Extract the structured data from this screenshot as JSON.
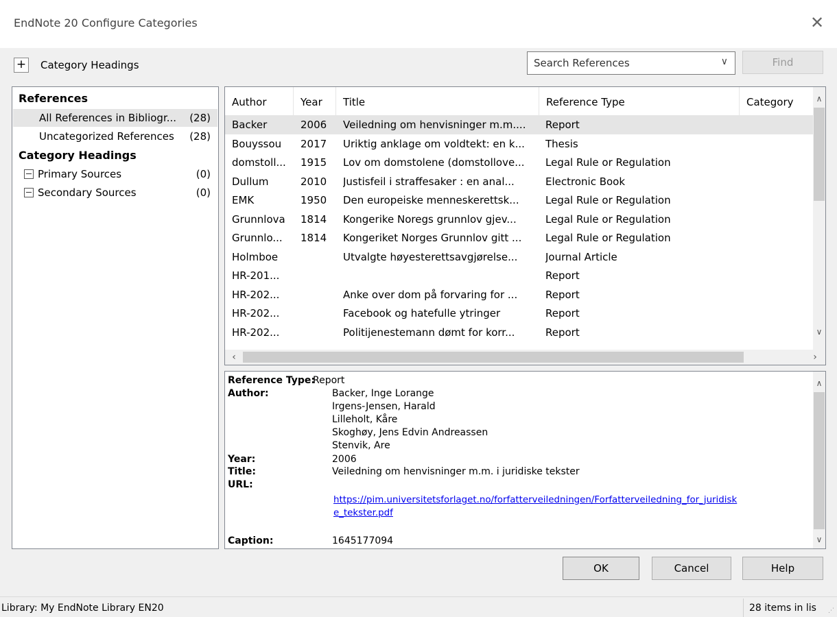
{
  "window": {
    "title": "EndNote 20 Configure Categories",
    "close_glyph": "✕"
  },
  "toolbar": {
    "add_glyph": "+",
    "label": "Category Headings"
  },
  "search": {
    "placeholder": "Search References",
    "find_label": "Find"
  },
  "sidebar": {
    "references_heading": "References",
    "items": [
      {
        "label": "All References in Bibliogr...",
        "count": "(28)"
      },
      {
        "label": "Uncategorized References",
        "count": "(28)"
      }
    ],
    "category_heading": "Category Headings",
    "categories": [
      {
        "label": "Primary Sources",
        "count": "(0)"
      },
      {
        "label": "Secondary Sources",
        "count": "(0)"
      }
    ]
  },
  "table": {
    "columns": [
      "Author",
      "Year",
      "Title",
      "Reference Type",
      "Category"
    ],
    "rows": [
      {
        "author": "Backer",
        "year": "2006",
        "title": "Veiledning om henvisninger m.m....",
        "type": "Report"
      },
      {
        "author": "Bouyssou",
        "year": "2017",
        "title": "Uriktig anklage om voldtekt: en k...",
        "type": "Thesis"
      },
      {
        "author": "domstoll...",
        "year": "1915",
        "title": "Lov om domstolene (domstollove...",
        "type": "Legal Rule or Regulation"
      },
      {
        "author": "Dullum",
        "year": "2010",
        "title": "Justisfeil i straffesaker : en anal...",
        "type": "Electronic Book"
      },
      {
        "author": "EMK",
        "year": "1950",
        "title": "Den europeiske menneskerettsk...",
        "type": "Legal Rule or Regulation"
      },
      {
        "author": "Grunnlova",
        "year": "1814",
        "title": "Kongerike Noregs grunnlov gjev...",
        "type": "Legal Rule or Regulation"
      },
      {
        "author": "Grunnlo...",
        "year": "1814",
        "title": "Kongeriket Norges Grunnlov gitt ...",
        "type": "Legal Rule or Regulation"
      },
      {
        "author": "Holmboe",
        "year": "",
        "title": "Utvalgte høyesterettsavgjørelse...",
        "type": "Journal Article"
      },
      {
        "author": "HR-201...",
        "year": "",
        "title": "",
        "type": "Report"
      },
      {
        "author": "HR-202...",
        "year": "",
        "title": "Anke over dom på forvaring for ...",
        "type": "Report"
      },
      {
        "author": "HR-202...",
        "year": "",
        "title": "Facebook og hatefulle ytringer",
        "type": "Report"
      },
      {
        "author": "HR-202...",
        "year": "",
        "title": "Politijenestemann dømt for korr...",
        "type": "Report"
      }
    ]
  },
  "detail": {
    "type_label": "Reference Type:",
    "type_value": "Report",
    "author_label": "Author:",
    "authors": [
      "Backer, Inge Lorange",
      "Irgens-Jensen, Harald",
      "Lilleholt, Kåre",
      "Skoghøy, Jens Edvin Andreassen",
      "Stenvik, Are"
    ],
    "year_label": "Year:",
    "year_value": "2006",
    "title_label": "Title:",
    "title_value": "Veiledning om henvisninger m.m. i juridiske tekster",
    "url_label": "URL:",
    "url_line1": "https://pim.universitetsforlaget.no/forfatterveiledningen/Forfatterveiledning_for_juridisk",
    "url_line2": "e_tekster.pdf",
    "caption_label": "Caption:",
    "caption_value": "1645177094"
  },
  "buttons": {
    "ok": "OK",
    "cancel": "Cancel",
    "help": "Help"
  },
  "status": {
    "library": "Library: My EndNote Library EN20",
    "items": "28 items in lis"
  },
  "glyphs": {
    "up": "∧",
    "down": "∨",
    "left": "‹",
    "right": "›",
    "chev": "∨"
  }
}
